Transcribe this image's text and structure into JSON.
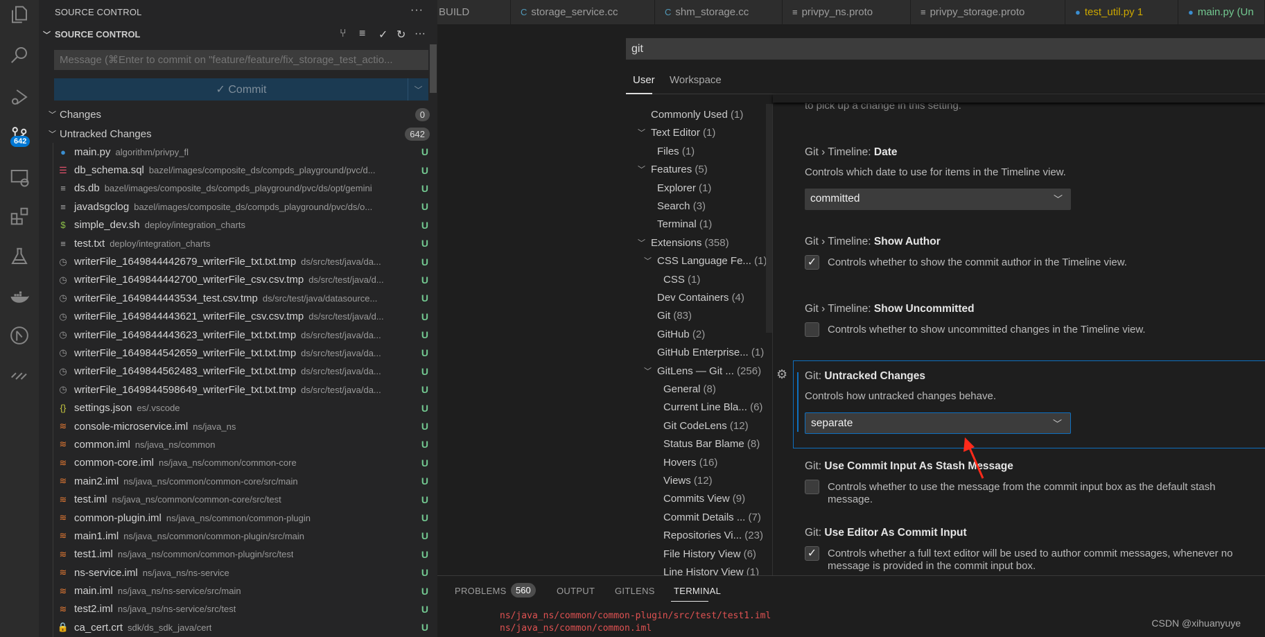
{
  "activity_bar": {
    "scm_badge": "642",
    "items": [
      "explorer",
      "search",
      "run-debug",
      "source-control",
      "remote-explorer",
      "extensions",
      "testing",
      "docker",
      "gitlens",
      "gitlens-inspect"
    ]
  },
  "sidebar": {
    "title": "SOURCE CONTROL",
    "section": "SOURCE CONTROL",
    "message_placeholder": "Message (⌘Enter to commit on \"feature/feature/fix_storage_test_actio...",
    "commit_label": "✓ Commit",
    "changes": {
      "label": "Changes",
      "count": "0"
    },
    "untracked": {
      "label": "Untracked Changes",
      "count": "642"
    },
    "files": [
      {
        "name": "main.py",
        "path": "algorithm/privpy_fl",
        "icon": "python",
        "status": "U"
      },
      {
        "name": "db_schema.sql",
        "path": "bazel/images/composite_ds/compds_playground/pvc/d...",
        "icon": "database",
        "status": "U"
      },
      {
        "name": "ds.db",
        "path": "bazel/images/composite_ds/compds_playground/pvc/ds/opt/gemini",
        "icon": "lines",
        "status": "U"
      },
      {
        "name": "javadsgclog",
        "path": "bazel/images/composite_ds/compds_playground/pvc/ds/o...",
        "icon": "lines",
        "status": "U"
      },
      {
        "name": "simple_dev.sh",
        "path": "deploy/integration_charts",
        "icon": "shell",
        "status": "U"
      },
      {
        "name": "test.txt",
        "path": "deploy/integration_charts",
        "icon": "lines",
        "status": "U"
      },
      {
        "name": "writerFile_1649844442679_writerFile_txt.txt.tmp",
        "path": "ds/src/test/java/da...",
        "icon": "clock",
        "status": "U"
      },
      {
        "name": "writerFile_1649844442700_writerFile_csv.csv.tmp",
        "path": "ds/src/test/java/d...",
        "icon": "clock",
        "status": "U"
      },
      {
        "name": "writerFile_1649844443534_test.csv.tmp",
        "path": "ds/src/test/java/datasource...",
        "icon": "clock",
        "status": "U"
      },
      {
        "name": "writerFile_1649844443621_writerFile_csv.csv.tmp",
        "path": "ds/src/test/java/d...",
        "icon": "clock",
        "status": "U"
      },
      {
        "name": "writerFile_1649844443623_writerFile_txt.txt.tmp",
        "path": "ds/src/test/java/da...",
        "icon": "clock",
        "status": "U"
      },
      {
        "name": "writerFile_1649844542659_writerFile_txt.txt.tmp",
        "path": "ds/src/test/java/da...",
        "icon": "clock",
        "status": "U"
      },
      {
        "name": "writerFile_1649844562483_writerFile_txt.txt.tmp",
        "path": "ds/src/test/java/da...",
        "icon": "clock",
        "status": "U"
      },
      {
        "name": "writerFile_1649844598649_writerFile_txt.txt.tmp",
        "path": "ds/src/test/java/da...",
        "icon": "clock",
        "status": "U"
      },
      {
        "name": "settings.json",
        "path": "es/.vscode",
        "icon": "json",
        "status": "U"
      },
      {
        "name": "console-microservice.iml",
        "path": "ns/java_ns",
        "icon": "rss",
        "status": "U"
      },
      {
        "name": "common.iml",
        "path": "ns/java_ns/common",
        "icon": "rss",
        "status": "U"
      },
      {
        "name": "common-core.iml",
        "path": "ns/java_ns/common/common-core",
        "icon": "rss",
        "status": "U"
      },
      {
        "name": "main2.iml",
        "path": "ns/java_ns/common/common-core/src/main",
        "icon": "rss",
        "status": "U"
      },
      {
        "name": "test.iml",
        "path": "ns/java_ns/common/common-core/src/test",
        "icon": "rss",
        "status": "U"
      },
      {
        "name": "common-plugin.iml",
        "path": "ns/java_ns/common/common-plugin",
        "icon": "rss",
        "status": "U"
      },
      {
        "name": "main1.iml",
        "path": "ns/java_ns/common/common-plugin/src/main",
        "icon": "rss",
        "status": "U"
      },
      {
        "name": "test1.iml",
        "path": "ns/java_ns/common/common-plugin/src/test",
        "icon": "rss",
        "status": "U"
      },
      {
        "name": "ns-service.iml",
        "path": "ns/java_ns/ns-service",
        "icon": "rss",
        "status": "U"
      },
      {
        "name": "main.iml",
        "path": "ns/java_ns/ns-service/src/main",
        "icon": "rss",
        "status": "U"
      },
      {
        "name": "test2.iml",
        "path": "ns/java_ns/ns-service/src/test",
        "icon": "rss",
        "status": "U"
      },
      {
        "name": "ca_cert.crt",
        "path": "sdk/ds_sdk_java/cert",
        "icon": "lock",
        "status": "U"
      }
    ]
  },
  "tabs": [
    {
      "label": "BUILD",
      "icon": "",
      "color": "#9d9d9d"
    },
    {
      "label": "storage_service.cc",
      "icon": "cpp",
      "color": "#9d9d9d"
    },
    {
      "label": "shm_storage.cc",
      "icon": "cpp",
      "color": "#9d9d9d"
    },
    {
      "label": "privpy_ns.proto",
      "icon": "lines",
      "color": "#9d9d9d"
    },
    {
      "label": "privpy_storage.proto",
      "icon": "lines",
      "color": "#9d9d9d"
    },
    {
      "label": "test_util.py 1",
      "icon": "python",
      "color": "#cca700"
    },
    {
      "label": "main.py (Un",
      "icon": "python",
      "color": "#73c991"
    }
  ],
  "settings": {
    "search_value": "git",
    "scope_tabs": [
      "User",
      "Workspace"
    ],
    "tree": [
      {
        "label": "Commonly Used",
        "count": "(1)",
        "level": 0,
        "chev": false
      },
      {
        "label": "Text Editor",
        "count": "(1)",
        "level": 0,
        "chev": true
      },
      {
        "label": "Files",
        "count": "(1)",
        "level": 1,
        "chev": false
      },
      {
        "label": "Features",
        "count": "(5)",
        "level": 0,
        "chev": true
      },
      {
        "label": "Explorer",
        "count": "(1)",
        "level": 1,
        "chev": false
      },
      {
        "label": "Search",
        "count": "(3)",
        "level": 1,
        "chev": false
      },
      {
        "label": "Terminal",
        "count": "(1)",
        "level": 1,
        "chev": false
      },
      {
        "label": "Extensions",
        "count": "(358)",
        "level": 0,
        "chev": true
      },
      {
        "label": "CSS Language Fe...",
        "count": "(1)",
        "level": 1,
        "chev": true
      },
      {
        "label": "CSS",
        "count": "(1)",
        "level": 2,
        "chev": false
      },
      {
        "label": "Dev Containers",
        "count": "(4)",
        "level": 1,
        "chev": false
      },
      {
        "label": "Git",
        "count": "(83)",
        "level": 1,
        "chev": false
      },
      {
        "label": "GitHub",
        "count": "(2)",
        "level": 1,
        "chev": false
      },
      {
        "label": "GitHub Enterprise...",
        "count": "(1)",
        "level": 1,
        "chev": false
      },
      {
        "label": "GitLens — Git ...",
        "count": "(256)",
        "level": 1,
        "chev": true
      },
      {
        "label": "General",
        "count": "(8)",
        "level": 2,
        "chev": false
      },
      {
        "label": "Current Line Bla...",
        "count": "(6)",
        "level": 2,
        "chev": false
      },
      {
        "label": "Git CodeLens",
        "count": "(12)",
        "level": 2,
        "chev": false
      },
      {
        "label": "Status Bar Blame",
        "count": "(8)",
        "level": 2,
        "chev": false
      },
      {
        "label": "Hovers",
        "count": "(16)",
        "level": 2,
        "chev": false
      },
      {
        "label": "Views",
        "count": "(12)",
        "level": 2,
        "chev": false
      },
      {
        "label": "Commits View",
        "count": "(9)",
        "level": 2,
        "chev": false
      },
      {
        "label": "Commit Details ...",
        "count": "(7)",
        "level": 2,
        "chev": false
      },
      {
        "label": "Repositories Vi...",
        "count": "(23)",
        "level": 2,
        "chev": false
      },
      {
        "label": "File History View",
        "count": "(6)",
        "level": 2,
        "chev": false
      },
      {
        "label": "Line History View",
        "count": "(1)",
        "level": 2,
        "chev": false
      }
    ],
    "clipped_text": "to pick up a change in this setting.",
    "items": {
      "timeline_date": {
        "prefix": "Git › Timeline: ",
        "name": "Date",
        "desc": "Controls which date to use for items in the Timeline view.",
        "value": "committed"
      },
      "show_author": {
        "prefix": "Git › Timeline: ",
        "name": "Show Author",
        "desc": "Controls whether to show the commit author in the Timeline view.",
        "checked": true
      },
      "show_uncommitted": {
        "prefix": "Git › Timeline: ",
        "name": "Show Uncommitted",
        "desc": "Controls whether to show uncommitted changes in the Timeline view.",
        "checked": false
      },
      "untracked_changes": {
        "prefix": "Git: ",
        "name": "Untracked Changes",
        "desc": "Controls how untracked changes behave.",
        "value": "separate"
      },
      "commit_input_stash": {
        "prefix": "Git: ",
        "name": "Use Commit Input As Stash Message",
        "desc": "Controls whether to use the message from the commit input box as the default stash message.",
        "checked": false
      },
      "editor_commit_input": {
        "prefix": "Git: ",
        "name": "Use Editor As Commit Input",
        "desc": "Controls whether a full text editor will be used to author commit messages, whenever no message is provided in the commit input box.",
        "checked": true
      }
    }
  },
  "panel": {
    "tabs": [
      "PROBLEMS",
      "OUTPUT",
      "GITLENS",
      "TERMINAL"
    ],
    "problems_count": "560",
    "active": "TERMINAL",
    "terminal_lines": [
      "ns/java_ns/common/common-plugin/src/test/test1.iml",
      "ns/java_ns/common/common.iml"
    ]
  },
  "watermark": "CSDN @xihuanyuye",
  "colors": {
    "accent": "#0078d4",
    "untracked": "#73c991",
    "focus_border": "#0e70c0",
    "annotation_arrow": "#ff2a1a",
    "terminal_error": "#e05252"
  }
}
